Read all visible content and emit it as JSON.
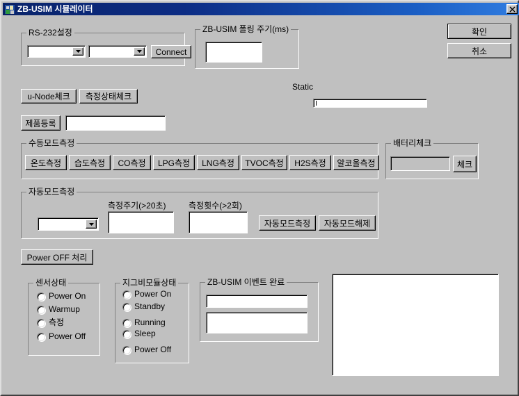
{
  "window": {
    "title": "ZB-USIM 시뮬레이터",
    "icon": "app-icon",
    "close_label": "close-icon",
    "bg_color": "#c0c0c0",
    "titlebar_color": "#0a246a"
  },
  "dialog_buttons": {
    "ok": "확인",
    "cancel": "취소"
  },
  "rs232": {
    "caption": "RS-232설정",
    "port_combo_value": "",
    "baud_combo_value": "",
    "connect_label": "Connect"
  },
  "polling": {
    "caption": "ZB-USIM 폴링 주기(ms)",
    "value": ""
  },
  "static_section": {
    "label": "Static",
    "value": ""
  },
  "check_buttons": {
    "unode": "u-Node체크",
    "measure_state": "측정상태체크"
  },
  "product": {
    "register_label": "제품등록",
    "value": ""
  },
  "manual_mode": {
    "caption": "수동모드측정",
    "buttons": [
      "온도측정",
      "습도측정",
      "CO측정",
      "LPG측정",
      "LNG측정",
      "TVOC측정",
      "H2S측정",
      "알코올측정"
    ]
  },
  "battery": {
    "caption": "배터리체크",
    "value": "",
    "check_label": "체크"
  },
  "auto_mode": {
    "caption": "자동모드측정",
    "combo_value": "",
    "period_label": "측정주기(>20초)",
    "period_value": "",
    "count_label": "측정횟수(>2회)",
    "count_value": "",
    "start_label": "자동모드측정",
    "stop_label": "자동모드해제"
  },
  "power_off": {
    "label": "Power OFF 처리"
  },
  "sensor_state": {
    "caption": "센서상태",
    "options": [
      "Power On",
      "Warmup",
      "측정",
      "Power Off"
    ]
  },
  "zigbee_state": {
    "caption": "지그비모듈상태",
    "options": [
      "Power On",
      "Standby",
      "Running",
      "Sleep",
      "Power Off"
    ]
  },
  "event_group": {
    "caption": "ZB-USIM 이벤트 완료",
    "field1": "",
    "field2": ""
  },
  "log_listbox": {
    "items": []
  }
}
